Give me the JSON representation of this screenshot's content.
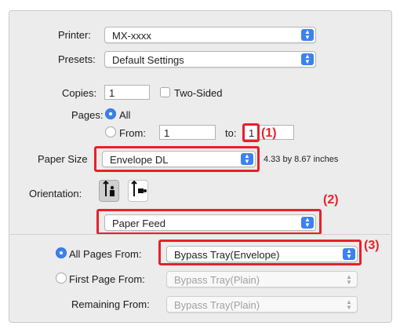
{
  "printer": {
    "label": "Printer:",
    "value": "MX-xxxx"
  },
  "presets": {
    "label": "Presets:",
    "value": "Default Settings"
  },
  "copies": {
    "label": "Copies:",
    "value": "1",
    "two_sided_label": "Two-Sided"
  },
  "pages": {
    "label": "Pages:",
    "all_label": "All",
    "from_label": "From:",
    "from_value": "1",
    "to_label": "to:",
    "to_value": "1"
  },
  "paper_size": {
    "label": "Paper Size",
    "value": "Envelope DL",
    "dimensions": "4.33 by 8.67 inches"
  },
  "orientation": {
    "label": "Orientation:"
  },
  "section_popup": {
    "value": "Paper Feed"
  },
  "paper_feed": {
    "all_pages_label": "All Pages From:",
    "all_pages_value": "Bypass Tray(Envelope)",
    "first_page_label": "First Page From:",
    "first_page_value": "Bypass Tray(Plain)",
    "remaining_label": "Remaining From:",
    "remaining_value": "Bypass Tray(Plain)"
  },
  "callouts": {
    "c1": "(1)",
    "c2": "(2)",
    "c3": "(3)"
  },
  "colors": {
    "accent": "#3b82f0",
    "callout": "#e8202a"
  }
}
